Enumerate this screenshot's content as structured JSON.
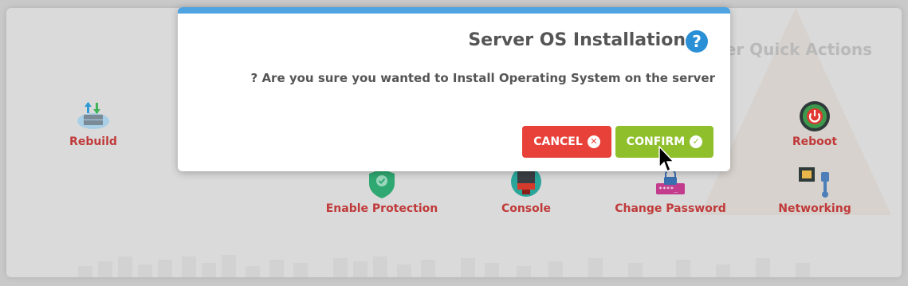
{
  "panel": {
    "title": "Server Quick Actions"
  },
  "actions": [
    {
      "label": "Rebuild",
      "icon": "cloud-server-icon"
    },
    {
      "label": "Reboot",
      "icon": "power-icon"
    },
    {
      "label": "Enable Protection",
      "icon": "shield-icon"
    },
    {
      "label": "Console",
      "icon": "terminal-icon"
    },
    {
      "label": "Change Password",
      "icon": "password-lock-icon"
    },
    {
      "label": "Networking",
      "icon": "network-cable-icon"
    }
  ],
  "modal": {
    "title": "Server OS Installation",
    "help_glyph": "?",
    "message": "? Are you sure you wanted to Install Operating System on the server",
    "cancel_label": "CANCEL",
    "confirm_label": "CONFIRM"
  },
  "colors": {
    "accent": "#4ea3e0",
    "cancel": "#e8413a",
    "confirm": "#8fbf2b",
    "action_label": "#c03a3a"
  }
}
